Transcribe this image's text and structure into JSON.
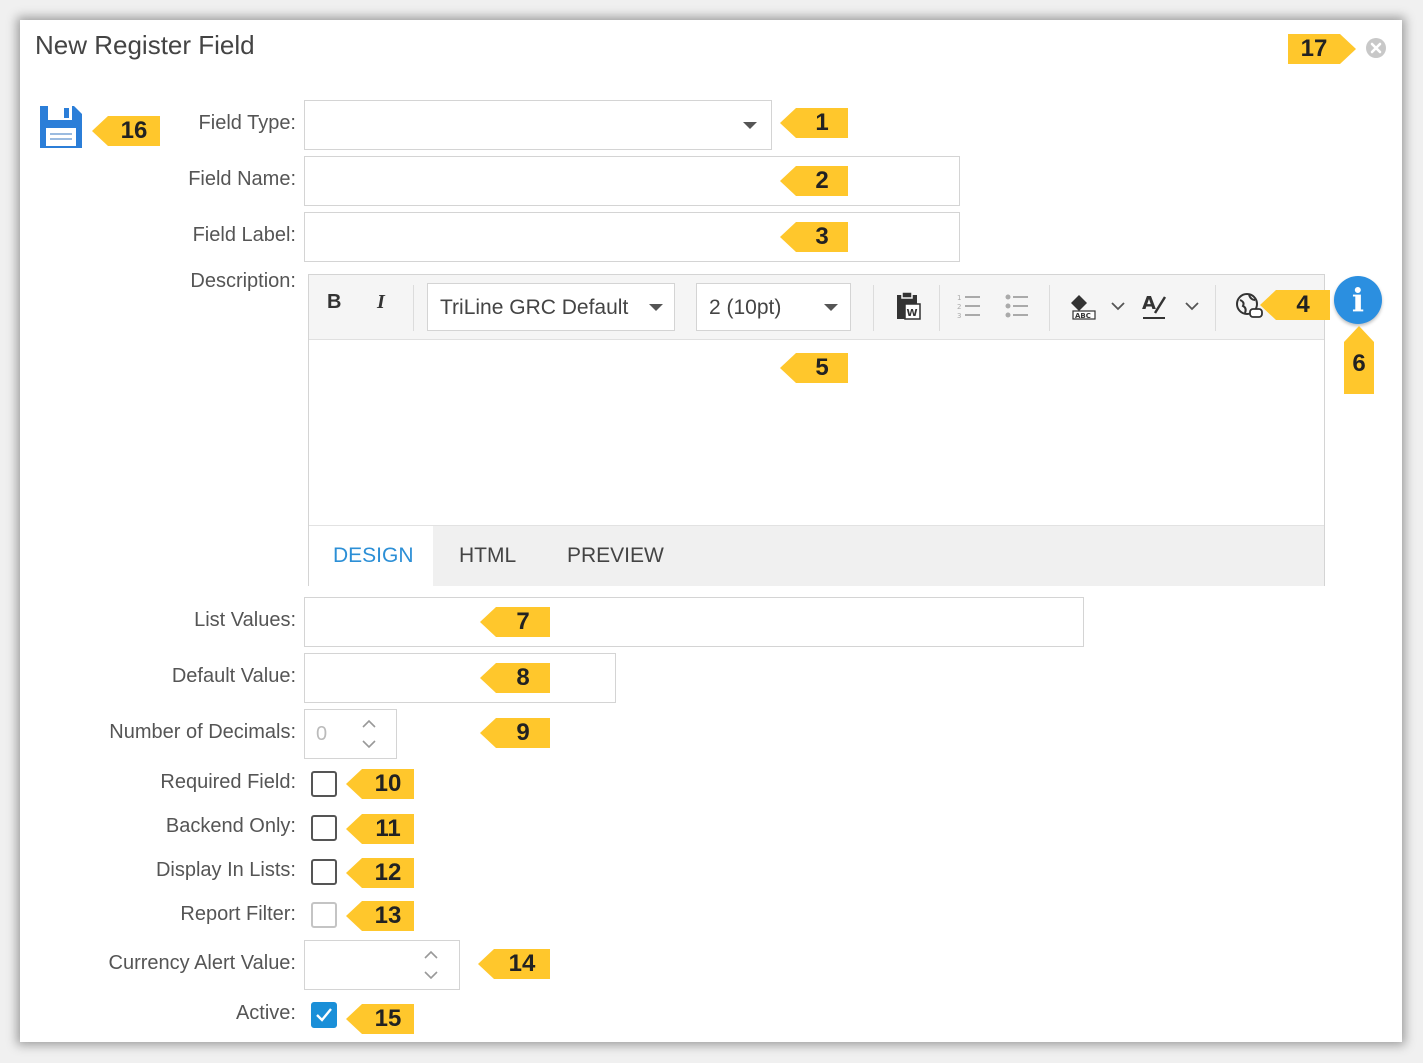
{
  "dialog": {
    "title": "New Register Field"
  },
  "form": {
    "field_type_label": "Field Type:",
    "field_name_label": "Field Name:",
    "field_label_label": "Field Label:",
    "description_label": "Description:",
    "list_values_label": "List Values:",
    "default_value_label": "Default Value:",
    "decimals_label": "Number of Decimals:",
    "decimals_value": "0",
    "required_label": "Required Field:",
    "backend_label": "Backend Only:",
    "display_lists_label": "Display In Lists:",
    "report_filter_label": "Report Filter:",
    "currency_label": "Currency Alert Value:",
    "active_label": "Active:",
    "checkboxes": {
      "required": false,
      "backend_only": false,
      "display_in_lists": false,
      "report_filter": false,
      "active": true
    }
  },
  "editor": {
    "bold_label": "B",
    "italic_label": "I",
    "font_value": "TriLine GRC Default",
    "size_value": "2 (10pt)",
    "tabs": [
      "DESIGN",
      "HTML",
      "PREVIEW"
    ],
    "active_tab": "DESIGN"
  },
  "callouts": [
    "1",
    "2",
    "3",
    "4",
    "5",
    "6",
    "7",
    "8",
    "9",
    "10",
    "11",
    "12",
    "13",
    "14",
    "15",
    "16",
    "17"
  ],
  "colors": {
    "callout": "#ffc72c",
    "accent": "#2c8fd6",
    "info": "#2b8fe0",
    "check": "#1a8fd8"
  },
  "icons": [
    "save-icon",
    "close-icon",
    "chevron-down-icon",
    "paste-word-icon",
    "ordered-list-icon",
    "unordered-list-icon",
    "format-icon",
    "spellcheck-icon",
    "link-icon",
    "info-icon",
    "check-icon",
    "spinner-icon"
  ]
}
